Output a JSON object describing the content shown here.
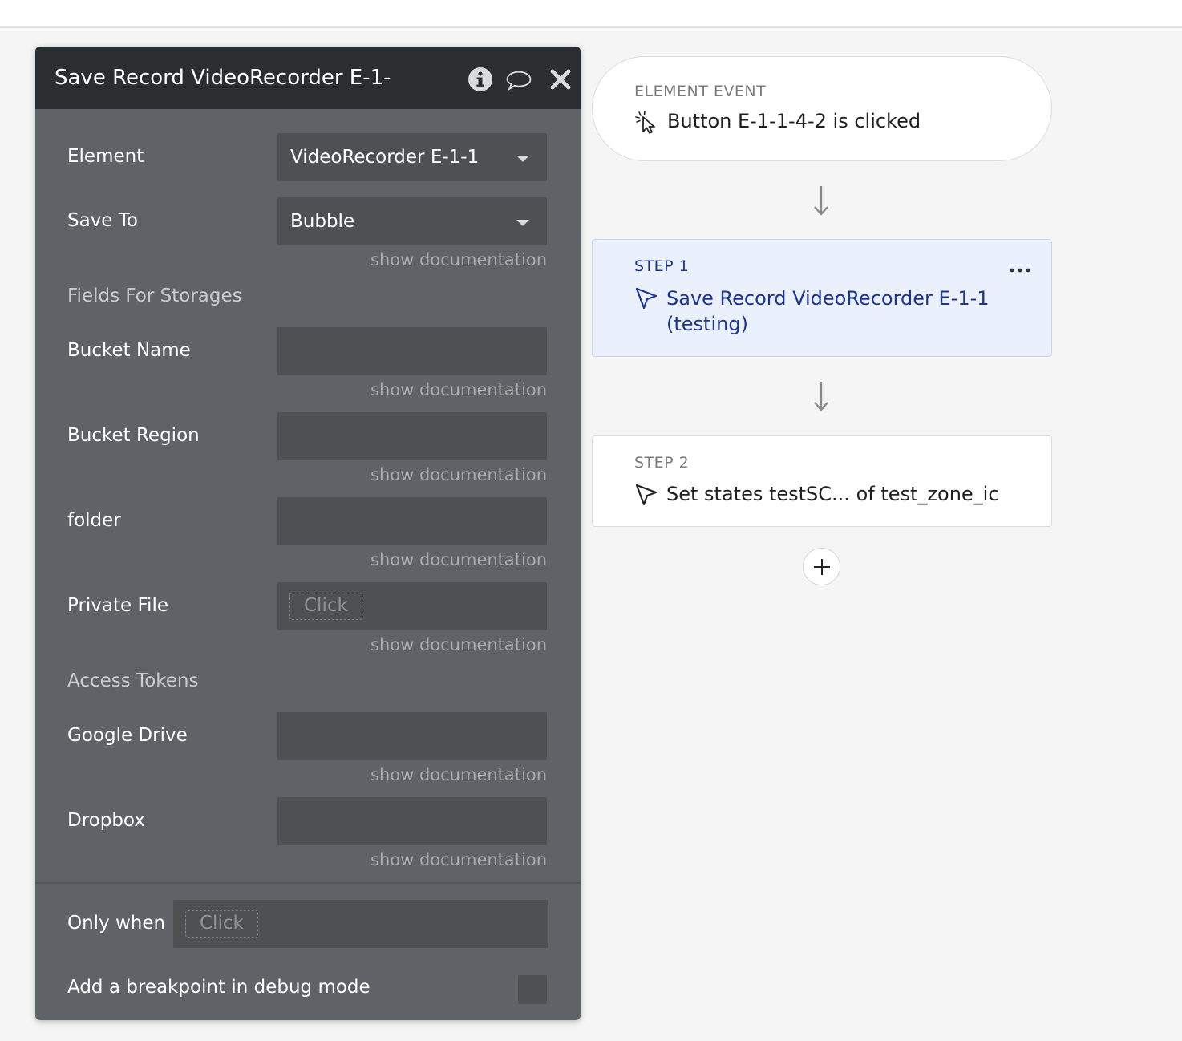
{
  "panel": {
    "title": "Save Record VideoRecorder E-1-",
    "header_icons": [
      "info-icon",
      "comment-icon",
      "close-icon"
    ],
    "element": {
      "label": "Element",
      "value": "VideoRecorder E-1-1"
    },
    "save_to": {
      "label": "Save To",
      "value": "Bubble",
      "doc": "show documentation"
    },
    "fields_for_storages": "Fields For Storages",
    "bucket_name": {
      "label": "Bucket Name",
      "value": "",
      "doc": "show documentation"
    },
    "bucket_region": {
      "label": "Bucket Region",
      "value": "",
      "doc": "show documentation"
    },
    "folder": {
      "label": "folder",
      "value": "",
      "doc": "show documentation"
    },
    "private_file": {
      "label": "Private File",
      "chip": "Click",
      "doc": "show documentation"
    },
    "access_tokens": "Access Tokens",
    "google_drive": {
      "label": "Google Drive",
      "value": "",
      "doc": "show documentation"
    },
    "dropbox": {
      "label": "Dropbox",
      "value": "",
      "doc": "show documentation"
    },
    "only_when": {
      "label": "Only when",
      "chip": "Click"
    },
    "breakpoint": {
      "label": "Add a breakpoint in debug mode",
      "checked": false
    }
  },
  "workflow": {
    "event": {
      "kicker": "ELEMENT EVENT",
      "text": "Button E-1-1-4-2 is clicked",
      "icon": "click-cursor-icon"
    },
    "step1": {
      "kicker": "STEP 1",
      "line1": "Save Record VideoRecorder E-1-1",
      "line2": "(testing)",
      "icon": "cursor-arrow-icon",
      "selected": true
    },
    "step2": {
      "kicker": "STEP 2",
      "text": "Set states testSC... of test_zone_ic",
      "icon": "cursor-arrow-icon"
    },
    "add_step_icon": "plus-icon"
  },
  "colors": {
    "panel_bg": "#5f6266",
    "panel_header": "#2b2e31",
    "field_bg": "#4e5154",
    "selected_step_bg": "#eaf0fc",
    "selected_step_text": "#1c3593"
  }
}
